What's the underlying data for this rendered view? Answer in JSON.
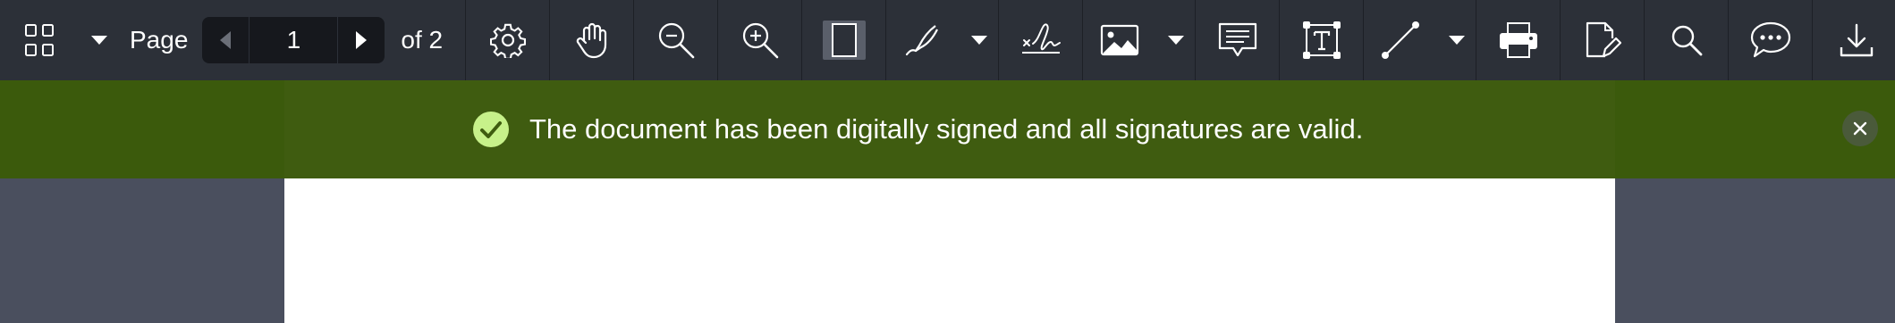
{
  "toolbar": {
    "page_label": "Page",
    "current_page": "1",
    "of_label": "of 2",
    "icons": [
      "thumbnails-grid-icon",
      "chevron-down-icon",
      "prev-page-icon",
      "next-page-icon",
      "settings-gear-icon",
      "pan-hand-icon",
      "zoom-out-icon",
      "zoom-in-icon",
      "fit-page-icon",
      "ink-pen-icon",
      "signature-icon",
      "image-icon",
      "comment-note-icon",
      "text-box-icon",
      "line-icon",
      "print-icon",
      "edit-document-icon",
      "search-icon",
      "chat-bubble-icon",
      "download-icon"
    ]
  },
  "banner": {
    "message": "The document has been digitally signed and all signatures are valid.",
    "status": "valid",
    "icon": "check-circle-icon",
    "close_icon": "close-icon"
  },
  "colors": {
    "toolbar_bg": "#2c3038",
    "banner_bg": "#3f5c10",
    "success_check": "#c7f18a",
    "workspace_bg": "#4a4f5e"
  }
}
